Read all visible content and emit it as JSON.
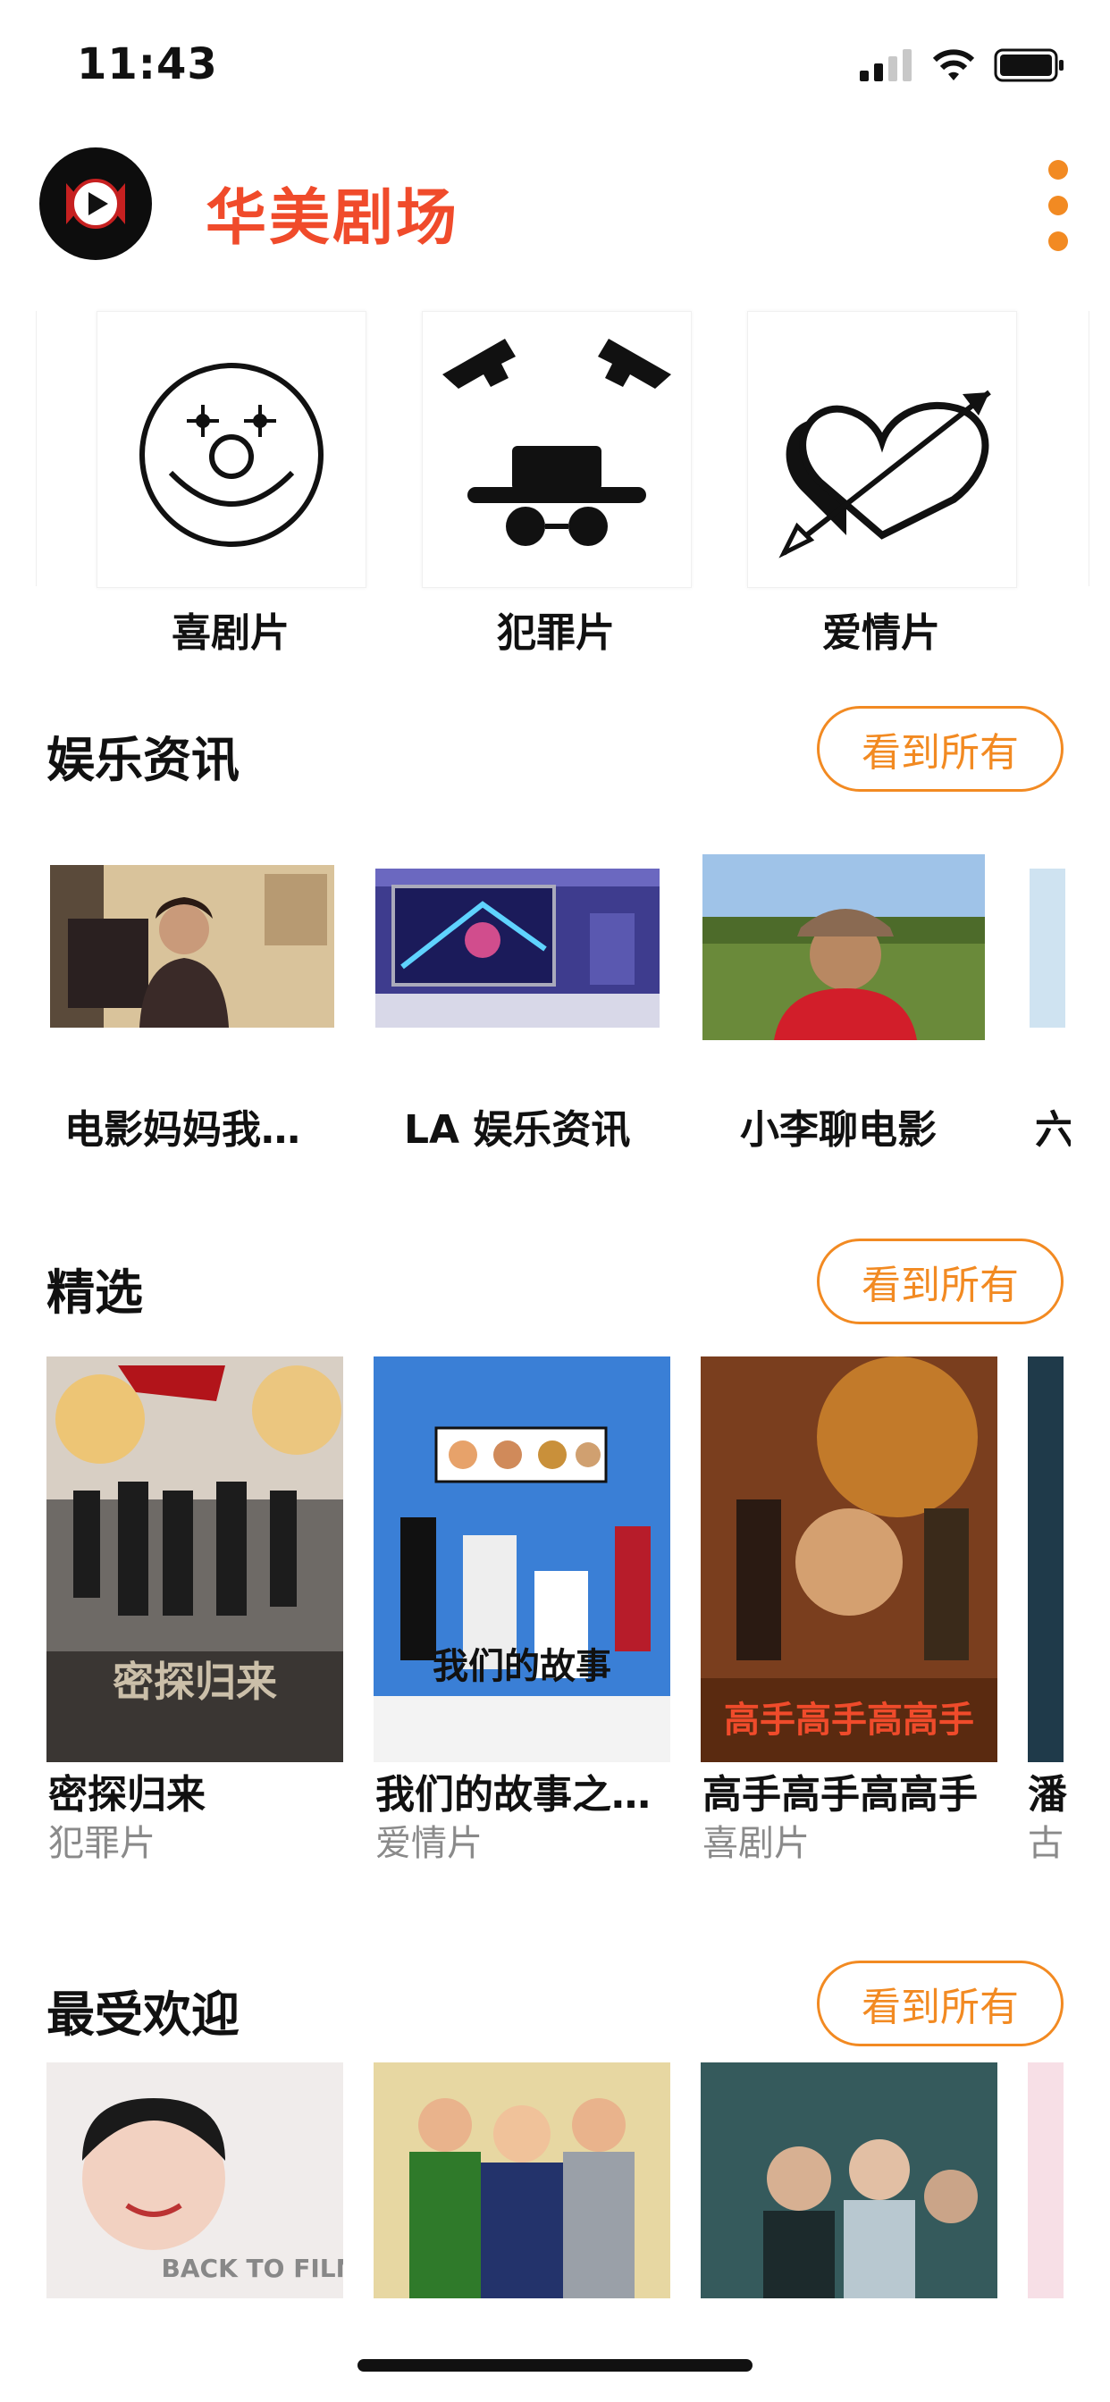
{
  "status": {
    "time": "11:43"
  },
  "header": {
    "app_title": "华美剧场"
  },
  "genres": [
    {
      "label": "喜剧片",
      "icon": "clown-face-icon"
    },
    {
      "label": "犯罪片",
      "icon": "gangster-guns-icon"
    },
    {
      "label": "爱情片",
      "icon": "heart-arrow-icon"
    }
  ],
  "sections": {
    "news": {
      "title": "娱乐资讯",
      "see_all": "看到所有",
      "items": [
        {
          "label": "电影妈妈我…"
        },
        {
          "label": "LA 娱乐资讯"
        },
        {
          "label": "小李聊电影"
        },
        {
          "label": "六"
        }
      ]
    },
    "featured": {
      "title": "精选",
      "see_all": "看到所有",
      "items": [
        {
          "title": "密探归来",
          "genre": "犯罪片",
          "poster_text": "密探归来"
        },
        {
          "title": "我们的故事之…",
          "genre": "爱情片",
          "poster_text": "我们的故事"
        },
        {
          "title": "高手高手高高手",
          "genre": "喜剧片",
          "poster_text": "高手高手高高手"
        },
        {
          "title": "潘",
          "genre": "古"
        }
      ]
    },
    "popular": {
      "title": "最受欢迎",
      "see_all": "看到所有",
      "items": [
        {
          "poster_text": "BACK TO FILM"
        },
        {},
        {}
      ]
    }
  },
  "colors": {
    "accent": "#f28a22",
    "brand": "#f04b2b"
  }
}
